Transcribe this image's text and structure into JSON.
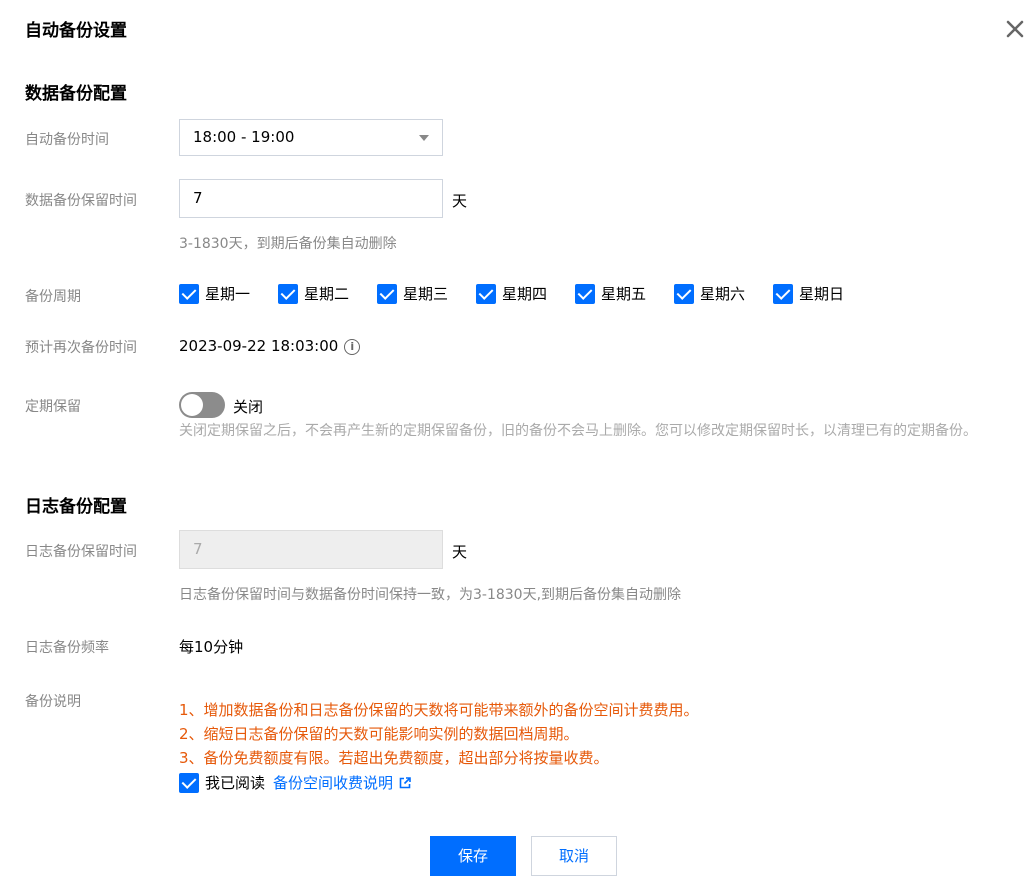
{
  "dialog": {
    "title": "自动备份设置"
  },
  "data_section": {
    "title": "数据备份配置",
    "auto_time": {
      "label": "自动备份时间",
      "value": "18:00 - 19:00"
    },
    "retention": {
      "label": "数据备份保留时间",
      "value": "7",
      "unit": "天",
      "hint": "3-1830天，到期后备份集自动删除"
    },
    "cycle": {
      "label": "备份周期",
      "days": [
        "星期一",
        "星期二",
        "星期三",
        "星期四",
        "星期五",
        "星期六",
        "星期日"
      ]
    },
    "next_time": {
      "label": "预计再次备份时间",
      "value": "2023-09-22 18:03:00"
    },
    "periodic": {
      "label": "定期保留",
      "toggle_label": "关闭",
      "desc": "关闭定期保留之后，不会再产生新的定期保留备份，旧的备份不会马上删除。您可以修改定期保留时长，以清理已有的定期备份。"
    }
  },
  "log_section": {
    "title": "日志备份配置",
    "retention": {
      "label": "日志备份保留时间",
      "value": "7",
      "unit": "天",
      "hint": "日志备份保留时间与数据备份时间保持一致，为3-1830天,到期后备份集自动删除"
    },
    "frequency": {
      "label": "日志备份频率",
      "value": "每10分钟"
    },
    "notes": {
      "label": "备份说明",
      "lines": [
        "1、增加数据备份和日志备份保留的天数将可能带来额外的备份空间计费费用。",
        "2、缩短日志备份保留的天数可能影响实例的数据回档周期。",
        "3、备份免费额度有限。若超出免费额度，超出部分将按量收费。"
      ],
      "agree_label": "我已阅读",
      "agree_link": "备份空间收费说明"
    }
  },
  "footer": {
    "save": "保存",
    "cancel": "取消"
  },
  "colors": {
    "primary": "#006eff",
    "warning": "#e6590a",
    "muted": "#888888"
  }
}
